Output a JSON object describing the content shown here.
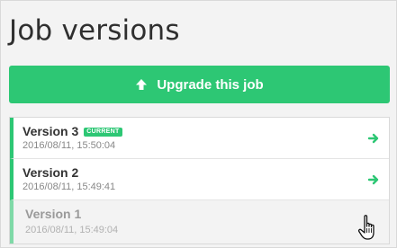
{
  "title": "Job versions",
  "upgrade_button": {
    "label": "Upgrade this job",
    "icon": "arrow-up-icon"
  },
  "versions": [
    {
      "name": "Version 3",
      "badge": "CURRENT",
      "date": "2016/08/11, 15:50:04",
      "icon": "arrow-right-icon"
    },
    {
      "name": "Version 2",
      "date": "2016/08/11, 15:49:41",
      "icon": "arrow-right-icon"
    },
    {
      "name": "Version 1",
      "date": "2016/08/11, 15:49:04"
    }
  ],
  "colors": {
    "accent": "#2dc774",
    "background": "#f3f3f3"
  }
}
